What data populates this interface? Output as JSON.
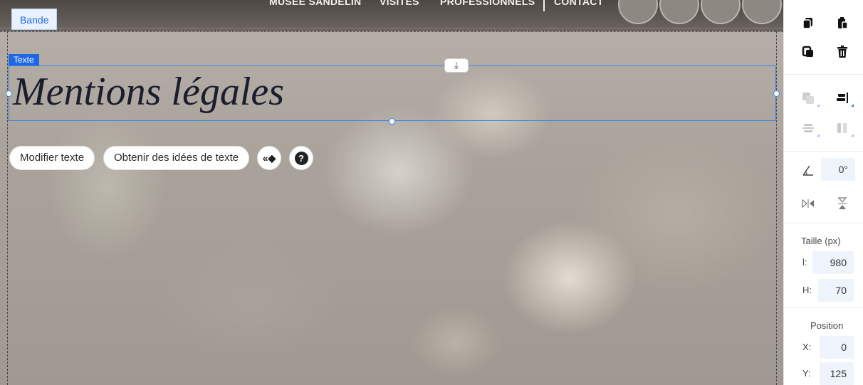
{
  "header": {
    "nav": [
      "MUSEE SANDELIN",
      "VISITES",
      "PROFESSIONNELS",
      "CONTACT"
    ],
    "social_icons": [
      "facebook-icon",
      "twitter-icon",
      "youtube-icon",
      "instagram-icon"
    ]
  },
  "canvas": {
    "band_label": "Bande",
    "selection_tag": "Texte",
    "anchor_icon": "⤓",
    "title": "Mentions légales",
    "actions": {
      "edit_text": "Modifier texte",
      "ideas_text": "Obtenir des idées de texte",
      "animation_icon": "«◆",
      "help_icon": "?"
    }
  },
  "panel": {
    "rotation": {
      "value": "0°"
    },
    "size": {
      "label": "Taille (px)",
      "w_prefix": "l:",
      "w_value": "980",
      "h_prefix": "H:",
      "h_value": "70"
    },
    "position": {
      "label": "Position",
      "x_prefix": "X:",
      "x_value": "0",
      "y_prefix": "Y:",
      "y_value": "125"
    }
  },
  "colors": {
    "selection": "#3b84e8",
    "selection_tag": "#1d67e2",
    "band_label_text": "#1f6be6",
    "field_bg": "#eef3fc"
  }
}
